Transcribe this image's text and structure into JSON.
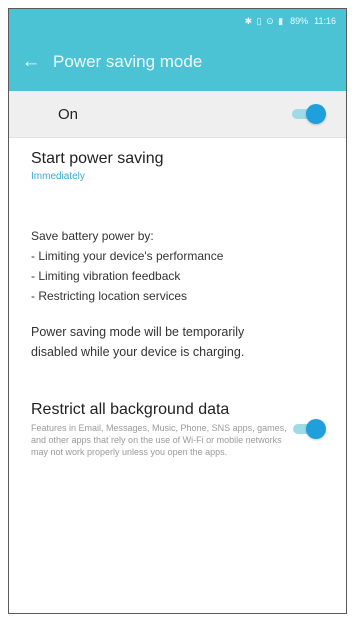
{
  "status_bar": {
    "icons": "✱ ▯ ⊙ ▮",
    "battery": "89%",
    "time": "11:16"
  },
  "app_bar": {
    "back_icon": "arrow-left-icon",
    "title": "Power saving mode"
  },
  "master_switch": {
    "label": "On",
    "state": true,
    "accent": "#1f9fdc"
  },
  "start_power_saving": {
    "title": "Start power saving",
    "value": "Immediately"
  },
  "description": {
    "lines": [
      "Save battery power by:",
      "- Limiting your device's performance",
      "- Limiting vibration feedback",
      "- Restricting location services"
    ]
  },
  "charging_note": {
    "lines": [
      "Power saving mode will be temporarily",
      "disabled while your device is charging."
    ]
  },
  "restrict_background": {
    "title": "Restrict all background data",
    "description": "Features in Email, Messages, Music, Phone, SNS apps, games, and other apps that rely on the use of Wi-Fi or mobile networks may not work properly unless you open the apps.",
    "state": true
  },
  "colors": {
    "header": "#4cc3d5",
    "accent": "#1f9fdc",
    "link": "#3aa9d3"
  }
}
